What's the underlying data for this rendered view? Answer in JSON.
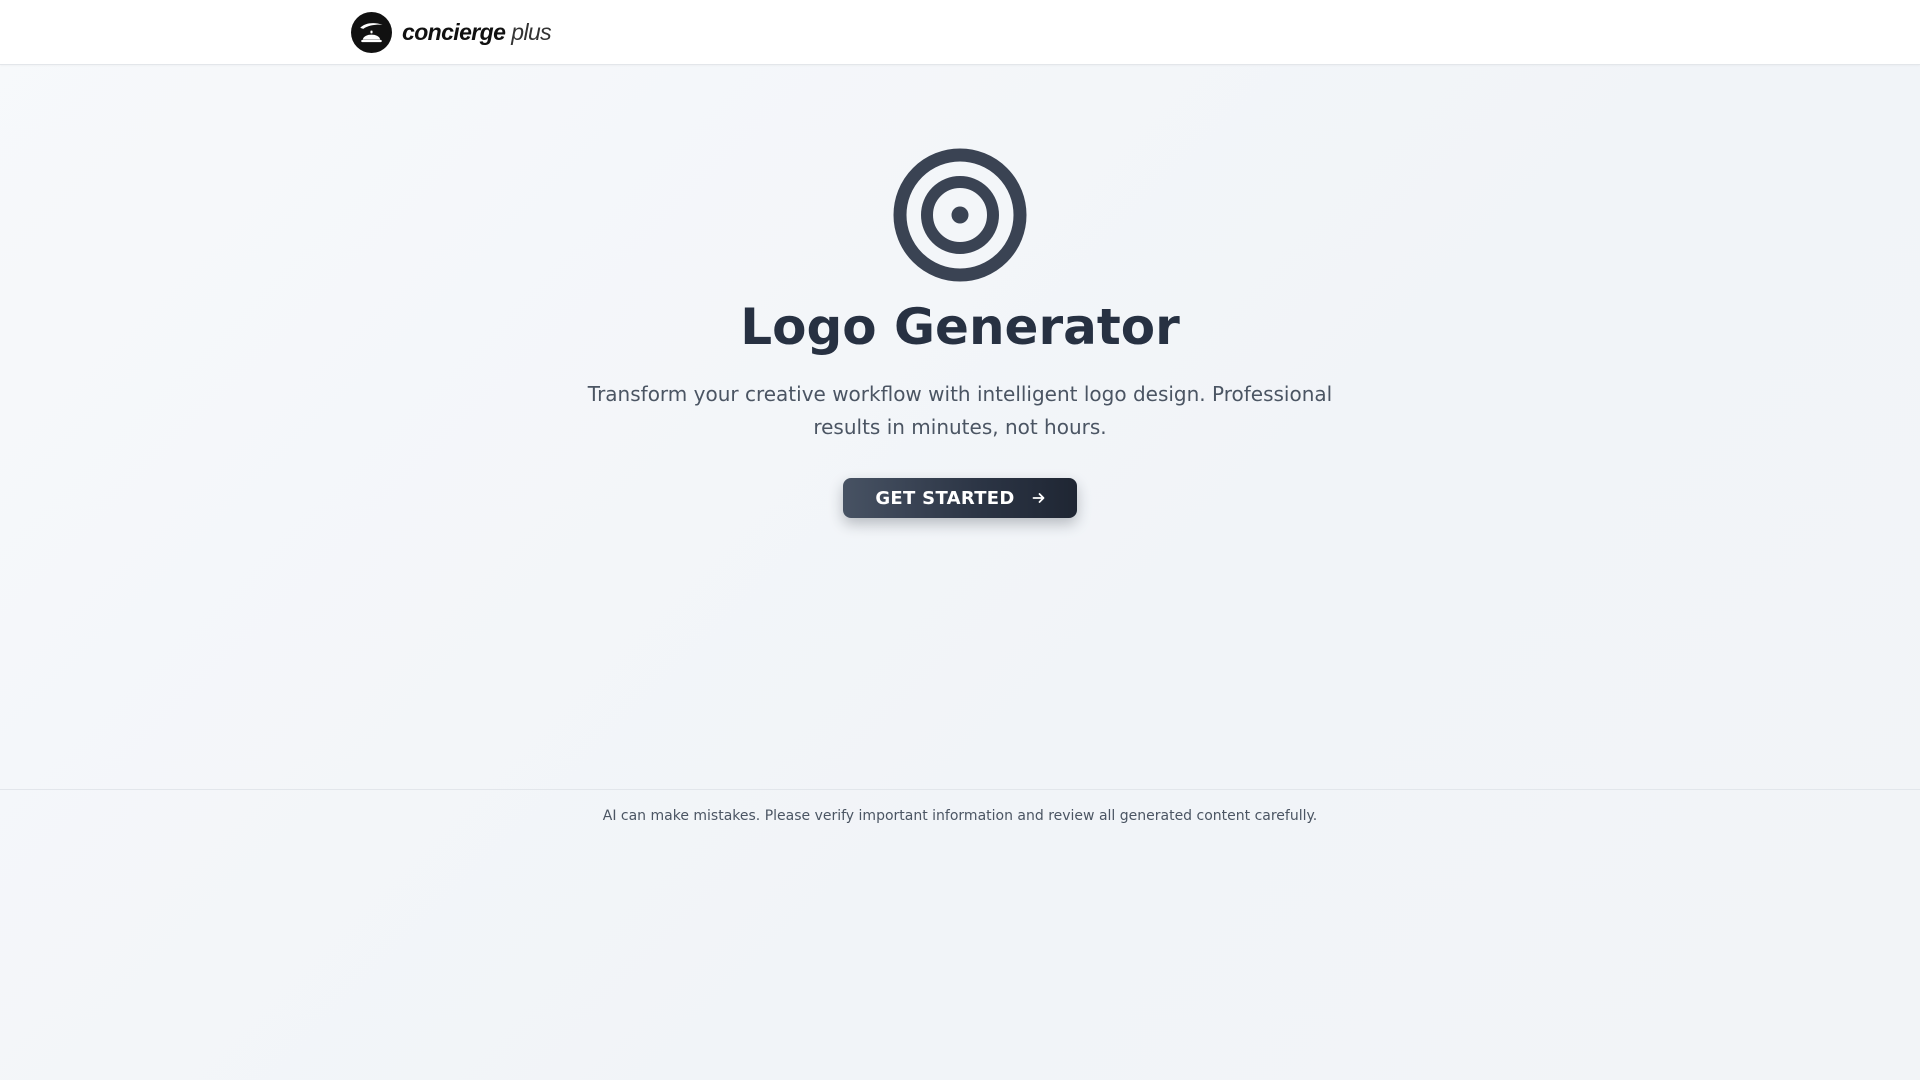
{
  "header": {
    "brand": {
      "name_primary": "concierge",
      "name_secondary": "plus",
      "logo_icon": "concierge-bell-icon"
    }
  },
  "hero": {
    "icon": "target-icon",
    "title": "Logo Generator",
    "subtitle": "Transform your creative workflow with intelligent logo design. Professional results in minutes, not hours.",
    "cta_label": "GET STARTED",
    "cta_icon": "arrow-right-icon"
  },
  "footer": {
    "disclaimer": "AI can make mistakes. Please verify important information and review all generated content carefully."
  },
  "colors": {
    "title": "#273142",
    "body_text": "#4b5563",
    "button_start": "#475263",
    "button_end": "#1f2633",
    "background": "#f3f5f8"
  }
}
